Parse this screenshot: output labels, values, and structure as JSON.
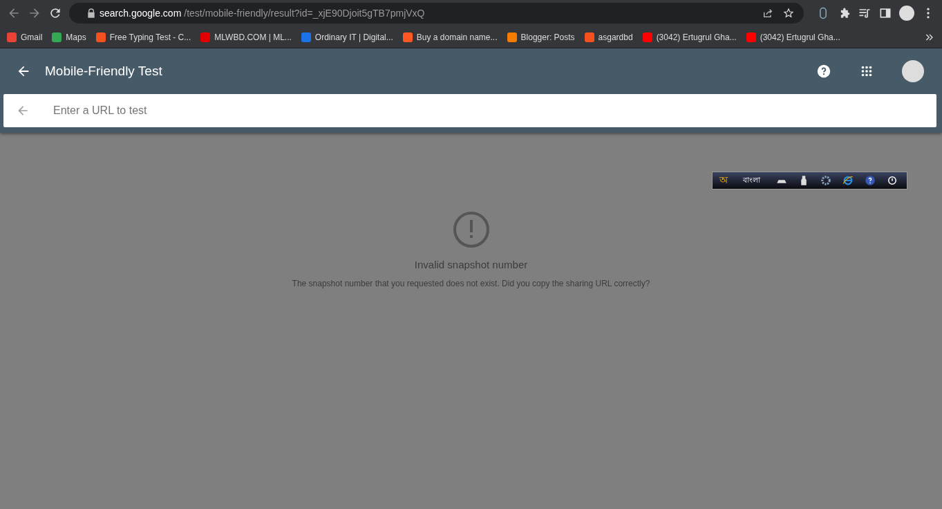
{
  "browser": {
    "url_host": "search.google.com",
    "url_path": "/test/mobile-friendly/result?id=_xjE90Djoit5gTB7pmjVxQ",
    "bookmarks": [
      {
        "label": "Gmail",
        "color": "#ea4335"
      },
      {
        "label": "Maps",
        "color": "#34a853"
      },
      {
        "label": "Free Typing Test - C...",
        "color": "#f4511e"
      },
      {
        "label": "MLWBD.COM | ML...",
        "color": "#e00000"
      },
      {
        "label": "Ordinary IT | Digital...",
        "color": "#1a73e8"
      },
      {
        "label": "Buy a domain name...",
        "color": "#ff5722"
      },
      {
        "label": "Blogger: Posts",
        "color": "#f57c00"
      },
      {
        "label": "asgardbd",
        "color": "#f4511e"
      },
      {
        "label": "(3042) Ertugrul Gha...",
        "color": "#ff0000"
      },
      {
        "label": "(3042) Ertugrul Gha...",
        "color": "#ff0000"
      }
    ]
  },
  "app_bar": {
    "title": "Mobile-Friendly Test"
  },
  "search": {
    "placeholder": "Enter a URL to test"
  },
  "ime_toolbar": {
    "logo": "অ",
    "language": "বাংলা"
  },
  "error": {
    "title": "Invalid snapshot number",
    "message": "The snapshot number that you requested does not exist. Did you copy the sharing URL correctly?"
  }
}
